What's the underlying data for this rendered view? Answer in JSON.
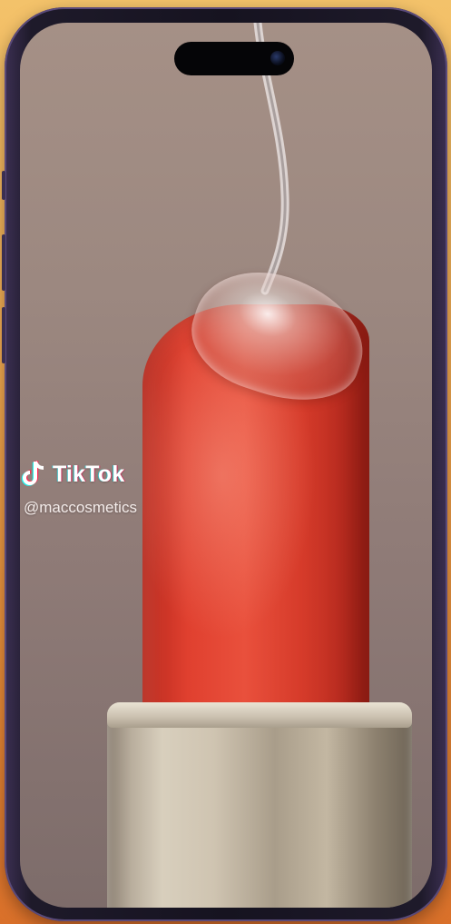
{
  "watermark": {
    "brand": "TikTok",
    "handle": "@maccosmetics"
  },
  "icons": {
    "tiktok_logo": "tiktok-note-icon",
    "front_camera": "camera-icon"
  },
  "colors": {
    "background_orange": "#f0a84f",
    "phone_frame": "#161320",
    "lipstick_red": "#e0402f",
    "cap_silver": "#cfc4b1"
  }
}
